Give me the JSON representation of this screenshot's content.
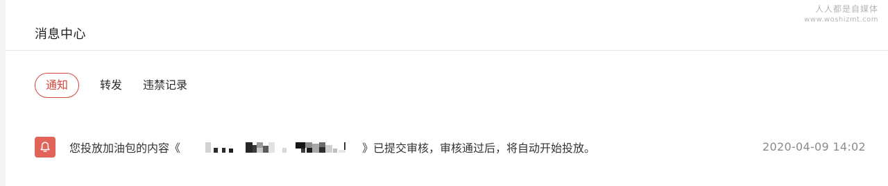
{
  "header": {
    "title": "消息中心"
  },
  "watermark": {
    "line1": "人人都是自媒体",
    "line2": "www.woshizmt.com"
  },
  "tabs": [
    {
      "label": "通知",
      "active": true
    },
    {
      "label": "转发",
      "active": false
    },
    {
      "label": "违禁记录",
      "active": false
    }
  ],
  "messages": [
    {
      "icon": "bell-icon",
      "text_before": "您投放加油包的内容《",
      "text_after": "》已提交审核，审核通过后，将自动开始投放。",
      "time": "2020-04-09 14:02"
    }
  ],
  "colors": {
    "accent": "#d0473d",
    "badge": "#e0645a"
  }
}
